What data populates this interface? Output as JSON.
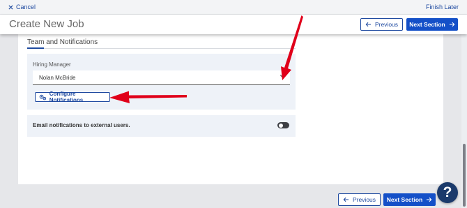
{
  "topbar": {
    "cancel_label": "Cancel",
    "finish_later_label": "Finish Later"
  },
  "header": {
    "title": "Create New Job",
    "previous_label": "Previous",
    "next_label": "Next Section"
  },
  "section": {
    "title": "Team and Notifications",
    "hiring_manager": {
      "label": "Hiring Manager",
      "value": "Nolan McBride"
    },
    "configure_notifications_label": "Configure Notifications",
    "external_email": {
      "label": "Email notifications to external users.",
      "enabled": false
    }
  },
  "footer": {
    "previous_label": "Previous",
    "next_label": "Next Section"
  },
  "help": {
    "label": "?"
  },
  "colors": {
    "brand_blue": "#1450c8",
    "link_blue": "#1f4aa0",
    "annotation_red": "#e0001a",
    "help_navy": "#1b3a6b"
  },
  "icons": {
    "cancel": "close-icon",
    "previous": "arrow-left-icon",
    "next": "arrow-right-icon",
    "dropdown": "chevron-down-icon",
    "configure": "gears-icon"
  }
}
